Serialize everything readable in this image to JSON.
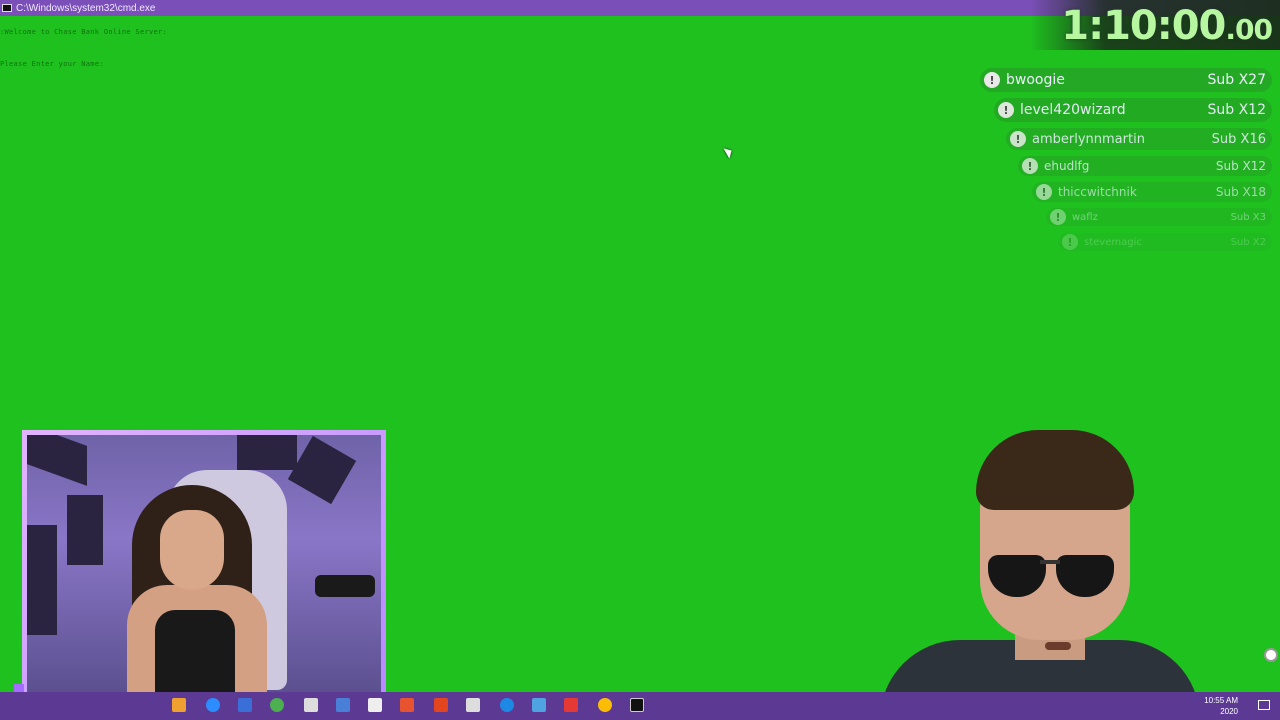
{
  "window": {
    "title": "C:\\Windows\\system32\\cmd.exe"
  },
  "console": {
    "line1": ":Welcome to Chase Bank Online Server:",
    "line2": "Please Enter your Name:"
  },
  "timer": {
    "main": "1:10:00",
    "cents": ".00"
  },
  "subs": [
    {
      "name": "bwoogie",
      "count": "Sub X27"
    },
    {
      "name": "level420wizard",
      "count": "Sub X12"
    },
    {
      "name": "amberlynnmartin",
      "count": "Sub X16"
    },
    {
      "name": "ehudlfg",
      "count": "Sub X12"
    },
    {
      "name": "thiccwitchnik",
      "count": "Sub X18"
    },
    {
      "name": "waflz",
      "count": "Sub X3"
    },
    {
      "name": "stevemagic",
      "count": "Sub X2"
    }
  ],
  "subs_badge": "!",
  "taskbar": {
    "time": "10:55 AM",
    "date": "2020"
  },
  "colors": {
    "green_screen": "#1fc11f",
    "titlebar": "#7b4fb8",
    "taskbar": "#5c3a93",
    "timer_text": "#b7f7a0",
    "webcam_border": "#c89bff"
  }
}
